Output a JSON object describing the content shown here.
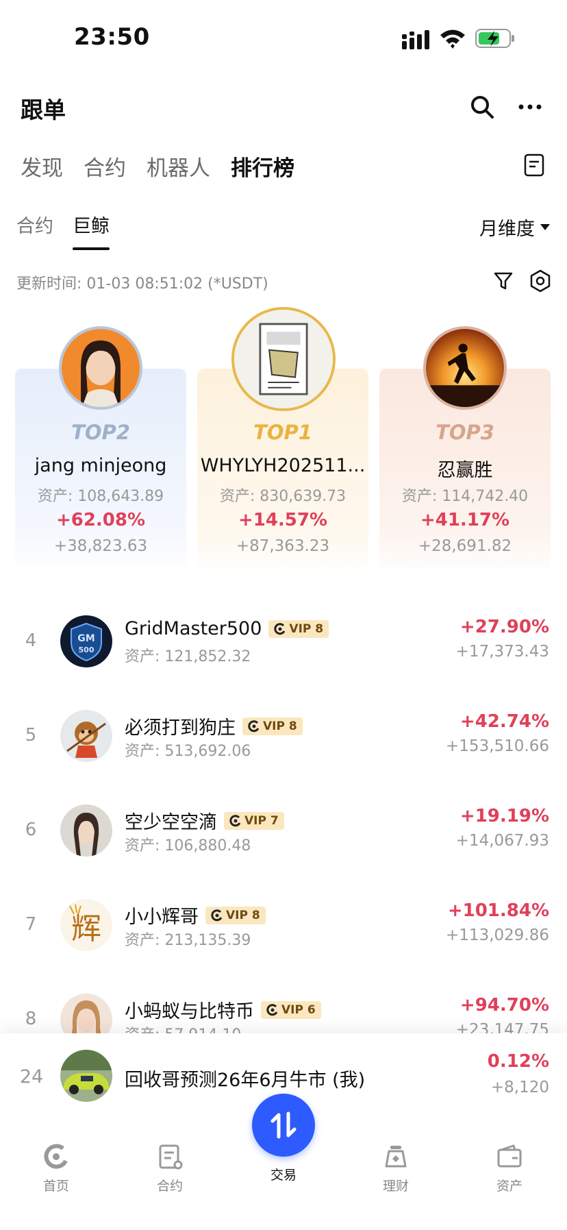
{
  "status_bar": {
    "time": "23:50"
  },
  "header": {
    "title": "跟单"
  },
  "main_tabs": [
    {
      "label": "发现",
      "active": false
    },
    {
      "label": "合约",
      "active": false
    },
    {
      "label": "机器人",
      "active": false
    },
    {
      "label": "排行榜",
      "active": true
    }
  ],
  "sub_tabs": [
    {
      "label": "合约",
      "active": false
    },
    {
      "label": "巨鲸",
      "active": true
    }
  ],
  "period": "月维度",
  "update_time": "更新时间: 01-03 08:51:02 (*USDT)",
  "podium": {
    "top2": {
      "rank": "TOP2",
      "name": "jang minjeong",
      "asset": "资产: 108,643.89",
      "pct": "+62.08%",
      "pnl": "+38,823.63"
    },
    "top1": {
      "rank": "TOP1",
      "name": "WHYLYH202511...",
      "asset": "资产: 830,639.73",
      "pct": "+14.57%",
      "pnl": "+87,363.23"
    },
    "top3": {
      "rank": "TOP3",
      "name": "忍赢胜",
      "asset": "资产: 114,742.40",
      "pct": "+41.17%",
      "pnl": "+28,691.82"
    }
  },
  "ranking": [
    {
      "rank": "4",
      "name": "GridMaster500",
      "vip": "VIP 8",
      "asset": "资产: 121,852.32",
      "pct": "+27.90%",
      "pnl": "+17,373.43",
      "avatar_text": "GM 500"
    },
    {
      "rank": "5",
      "name": "必须打到狗庄",
      "vip": "VIP 8",
      "asset": "资产: 513,692.06",
      "pct": "+42.74%",
      "pnl": "+153,510.66"
    },
    {
      "rank": "6",
      "name": "空少空空滴",
      "vip": "VIP 7",
      "asset": "资产: 106,880.48",
      "pct": "+19.19%",
      "pnl": "+14,067.93"
    },
    {
      "rank": "7",
      "name": "小小辉哥",
      "vip": "VIP 8",
      "asset": "资产: 213,135.39",
      "pct": "+101.84%",
      "pnl": "+113,029.86",
      "avatar_text": "辉"
    },
    {
      "rank": "8",
      "name": "小蚂蚁与比特币",
      "vip": "VIP 6",
      "asset": "资产: 57,914.10",
      "pct": "+94.70%",
      "pnl": "+23,147.75"
    }
  ],
  "my_rank": {
    "rank": "24",
    "name": "回收哥预测26年6月牛市 (我)",
    "pct": "0.12%",
    "pnl": "+8,120"
  },
  "bottom_nav": [
    {
      "label": "首页"
    },
    {
      "label": "合约"
    },
    {
      "label": "交易"
    },
    {
      "label": "理财"
    },
    {
      "label": "资产"
    }
  ],
  "colors": {
    "accent": "#2d5bff",
    "profit": "#e0405a",
    "gold": "#e9b341"
  }
}
